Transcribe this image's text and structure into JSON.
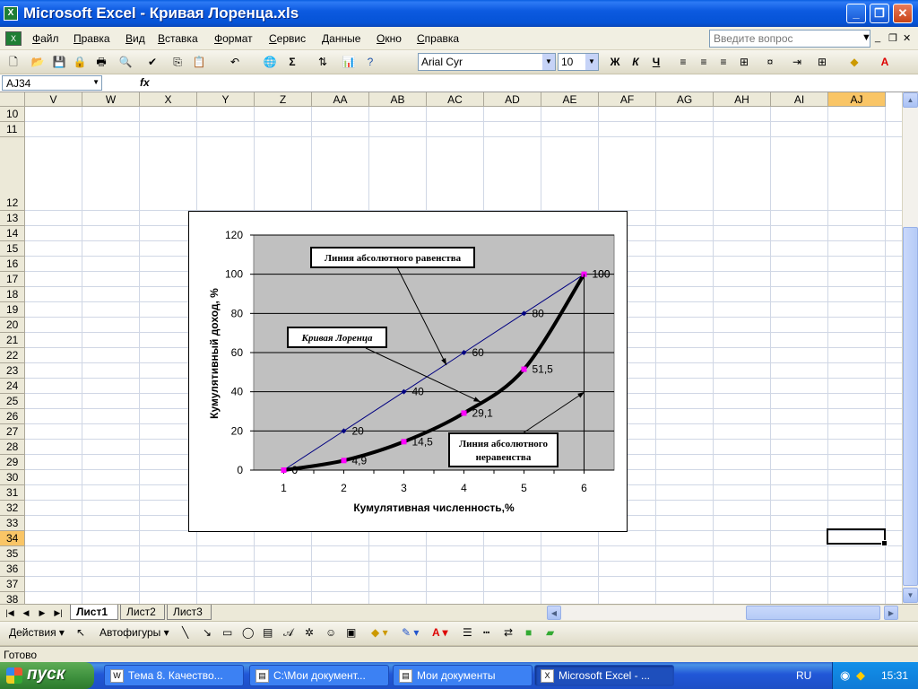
{
  "window": {
    "title": "Microsoft Excel - Кривая Лоренца.xls",
    "app_icon": "X"
  },
  "menu": {
    "items": [
      {
        "label": "Файл",
        "ul": "Ф",
        "rest": "айл"
      },
      {
        "label": "Правка",
        "ul": "П",
        "rest": "равка"
      },
      {
        "label": "Вид",
        "ul": "В",
        "rest": "ид"
      },
      {
        "label": "Вставка",
        "ul": "В",
        "rest": "ставка"
      },
      {
        "label": "Формат",
        "ul": "Ф",
        "rest": "ормат"
      },
      {
        "label": "Сервис",
        "ul": "С",
        "rest": "ервис"
      },
      {
        "label": "Данные",
        "ul": "Д",
        "rest": "анные"
      },
      {
        "label": "Окно",
        "ul": "О",
        "rest": "кно"
      },
      {
        "label": "Справка",
        "ul": "С",
        "rest": "правка"
      }
    ],
    "ask_placeholder": "Введите вопрос"
  },
  "toolbar": {
    "font_name": "Arial Cyr",
    "font_size": "10",
    "bold_label": "Ж",
    "italic_label": "К",
    "underline_label": "Ч",
    "sum_label": "Σ"
  },
  "formula_bar": {
    "name_box": "AJ34",
    "fx_label": "fx",
    "value": ""
  },
  "grid": {
    "columns": [
      "V",
      "W",
      "X",
      "Y",
      "Z",
      "AA",
      "AB",
      "AC",
      "AD",
      "AE",
      "AF",
      "AG",
      "AH",
      "AI",
      "AJ"
    ],
    "active_column": "AJ",
    "rows": [
      "10",
      "11",
      "12",
      "13",
      "14",
      "15",
      "16",
      "17",
      "18",
      "19",
      "20",
      "21",
      "22",
      "23",
      "24",
      "25",
      "26",
      "27",
      "28",
      "29",
      "30",
      "31",
      "32",
      "33",
      "34",
      "35",
      "36",
      "37",
      "38"
    ],
    "active_row": "34",
    "selected_cell": "AJ34"
  },
  "sheets": {
    "tabs": [
      "Лист1",
      "Лист2",
      "Лист3"
    ],
    "active": "Лист1"
  },
  "drawing_toolbar": {
    "actions_label": "Действия",
    "autoshapes_label": "Автофигуры"
  },
  "status": {
    "text": "Готово"
  },
  "taskbar": {
    "start_label": "пуск",
    "tasks": [
      {
        "label": "Тема 8. Качество...",
        "active": false,
        "icon": "word-icon"
      },
      {
        "label": "C:\\Мои документ...",
        "active": false,
        "icon": "folder-icon"
      },
      {
        "label": "Мои документы",
        "active": false,
        "icon": "folder-icon"
      },
      {
        "label": "Microsoft Excel - ...",
        "active": true,
        "icon": "excel-icon"
      }
    ],
    "language": "RU",
    "clock": "15:31"
  },
  "chart_data": {
    "type": "line",
    "x": [
      1,
      2,
      3,
      4,
      5,
      6
    ],
    "xlabel": "Кумулятивная численность,%",
    "ylabel": "Кумулятивный доход, %",
    "ylim": [
      0,
      120
    ],
    "yticks": [
      0,
      20,
      40,
      60,
      80,
      100,
      120
    ],
    "series": [
      {
        "values": [
          0,
          20,
          40,
          60,
          80,
          100
        ],
        "labels": [
          "0",
          "20",
          "40",
          "60",
          "80",
          "100"
        ],
        "color": "#000080"
      },
      {
        "values": [
          0,
          4.9,
          14.5,
          29.1,
          51.5,
          100
        ],
        "labels": [
          "0",
          "4,9",
          "14,5",
          "29,1",
          "51,5",
          "100"
        ],
        "color": "#000000"
      }
    ],
    "plot_background": "#c0c0c0",
    "annotations": [
      "Линия абсолютного равенства",
      "Кривая Лоренца",
      "Линия абсолютного неравенства"
    ]
  }
}
